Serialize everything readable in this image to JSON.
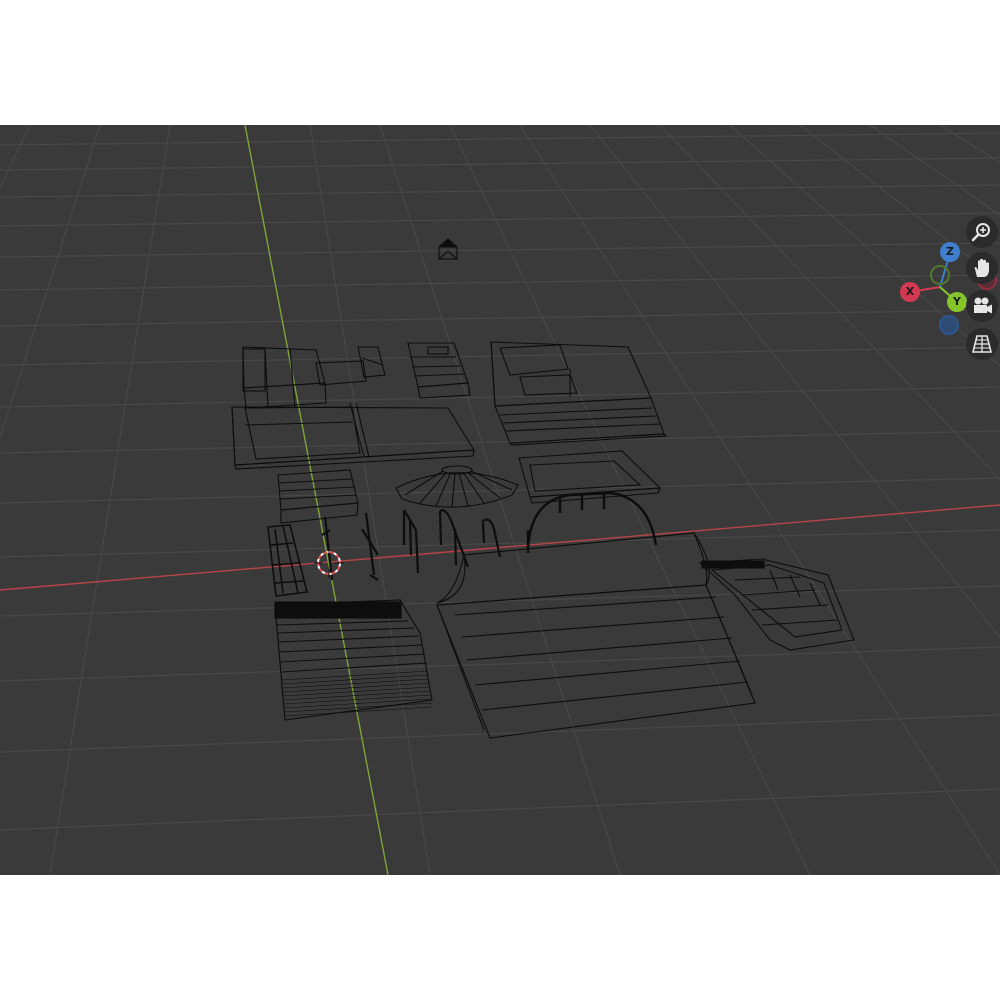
{
  "colors": {
    "background": "#3a3a3a",
    "grid": "#4a4a4a",
    "x_axis": "#b8434a",
    "y_axis": "#7ea43a",
    "wire": "#0d0d0d",
    "gizmo_x": "#d33a52",
    "gizmo_y": "#86c52a",
    "gizmo_z": "#3f7fcf",
    "cursor": "#e04b4b"
  },
  "gizmo": {
    "x_label": "X",
    "y_label": "Y",
    "z_label": "Z"
  },
  "navigation": [
    {
      "name": "zoom",
      "icon": "magnifier-plus-icon"
    },
    {
      "name": "pan",
      "icon": "hand-icon"
    },
    {
      "name": "camera",
      "icon": "camera-icon"
    },
    {
      "name": "perspective",
      "icon": "grid-perspective-icon"
    }
  ],
  "scene_objects": [
    "stair-platform",
    "ledge-box",
    "funbox",
    "box-ramp",
    "long-ledge",
    "flat-box",
    "dome",
    "quarter-pipe-small",
    "rail-frame",
    "rail",
    "rail",
    "rail",
    "rail",
    "rail",
    "arch-rail",
    "quarter-pipe",
    "wide-ramp",
    "bowl-ramp",
    "camera"
  ]
}
